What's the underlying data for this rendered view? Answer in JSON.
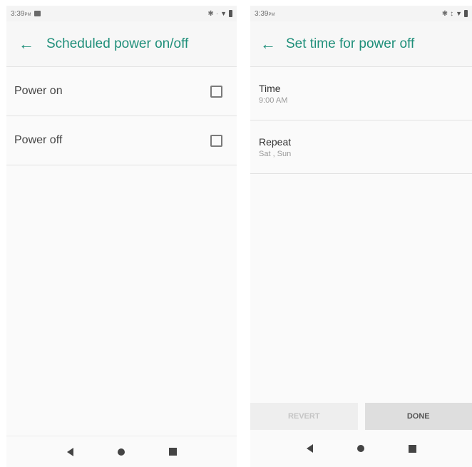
{
  "left": {
    "status": {
      "time": "3:39",
      "ampm": "PM"
    },
    "appbar": {
      "back_icon": "arrow-left-icon",
      "title": "Scheduled power on/off"
    },
    "rows": [
      {
        "label": "Power on"
      },
      {
        "label": "Power off"
      }
    ]
  },
  "right": {
    "status": {
      "time": "3:39",
      "ampm": "PM"
    },
    "appbar": {
      "back_icon": "arrow-left-icon",
      "title": "Set time for power off"
    },
    "items": [
      {
        "title": "Time",
        "subtitle": "9:00 AM"
      },
      {
        "title": "Repeat",
        "subtitle": "Sat , Sun"
      }
    ],
    "buttons": {
      "revert": "REVERT",
      "done": "DONE"
    }
  },
  "colors": {
    "accent": "#1f8f7a"
  }
}
